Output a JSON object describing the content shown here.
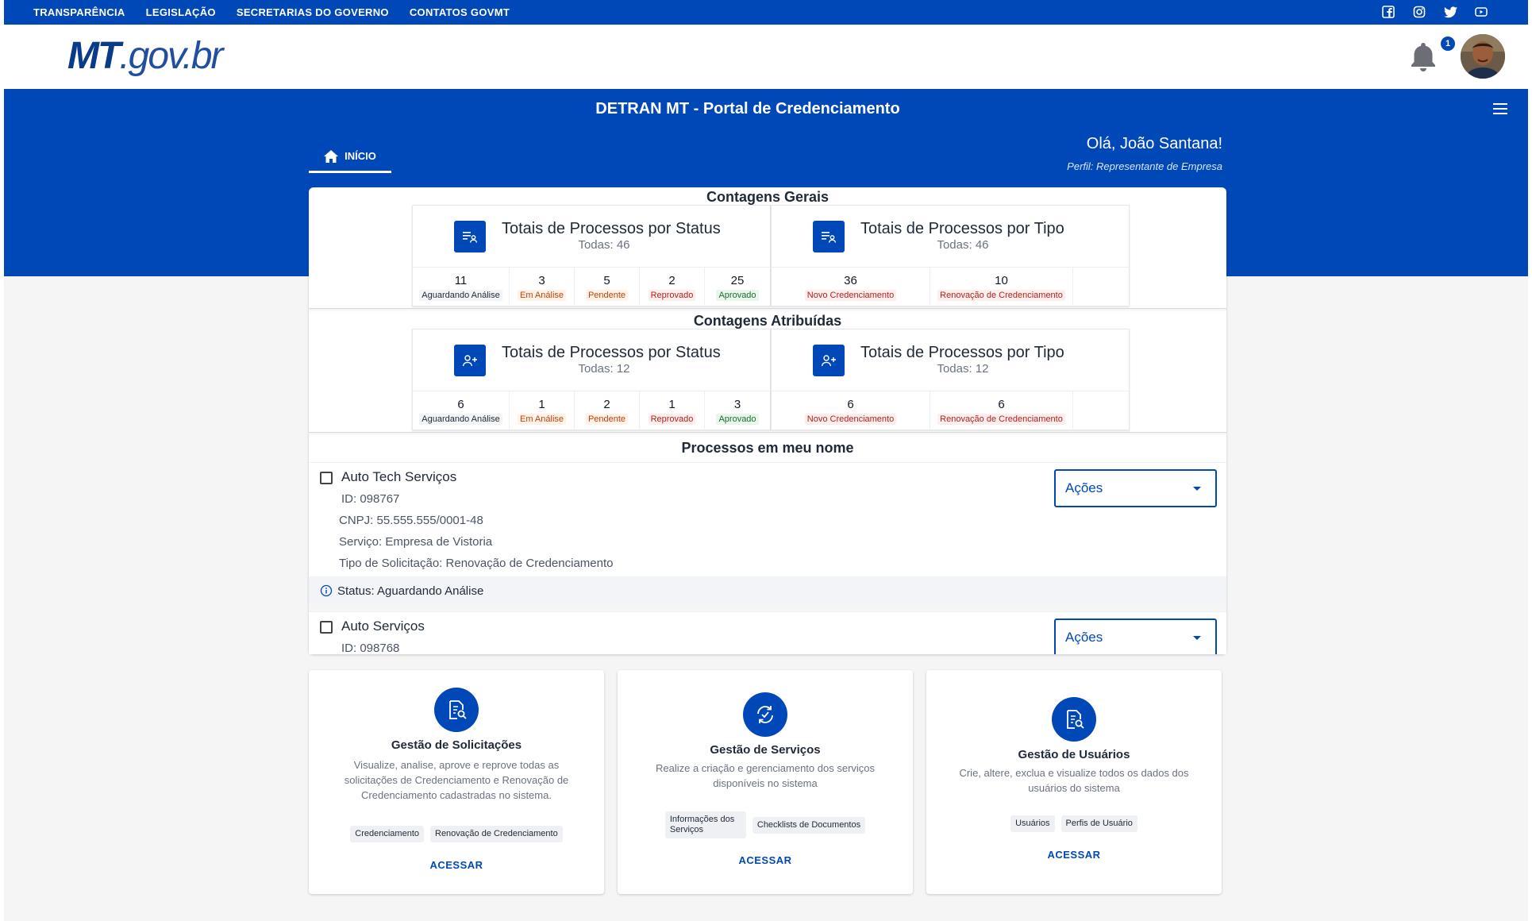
{
  "top_bar": {
    "links": [
      "TRANSPARÊNCIA",
      "LEGISLAÇÃO",
      "SECRETARIAS DO GOVERNO",
      "CONTATOS GOVMT"
    ],
    "social_icons": [
      "facebook-icon",
      "instagram-icon",
      "twitter-icon",
      "youtube-icon"
    ]
  },
  "header": {
    "logo_main": "MT",
    "logo_rest": ".gov.br",
    "notification_count": "1"
  },
  "banner": {
    "title": "DETRAN MT - Portal de Credenciamento",
    "tab_label": "INÍCIO",
    "greeting": "Olá, João Santana!",
    "profile": "Perfil: Representante de Empresa"
  },
  "colors": {
    "brand_blue": "#0048b8",
    "chip_orange": "#c2410c",
    "chip_red": "#b42318",
    "chip_green": "#1e6b2f"
  },
  "contagens_gerais": {
    "title": "Contagens Gerais",
    "status_card": {
      "title": "Totais de Processos por Status",
      "subtitle": "Todas: 46",
      "counts": [
        {
          "value": "11",
          "label": "Aguardando Análise",
          "tone": "neutral"
        },
        {
          "value": "3",
          "label": "Em Análise",
          "tone": "orange"
        },
        {
          "value": "5",
          "label": "Pendente",
          "tone": "orange"
        },
        {
          "value": "2",
          "label": "Reprovado",
          "tone": "red"
        },
        {
          "value": "25",
          "label": "Aprovado",
          "tone": "green"
        }
      ]
    },
    "type_card": {
      "title": "Totais de Processos por Tipo",
      "subtitle": "Todas: 46",
      "counts": [
        {
          "value": "36",
          "label": "Novo Credenciamento",
          "tone": "red"
        },
        {
          "value": "10",
          "label": "Renovação de Credenciamento",
          "tone": "red"
        }
      ]
    }
  },
  "contagens_atribuidas": {
    "title": "Contagens Atribuídas",
    "status_card": {
      "title": "Totais de Processos por Status",
      "subtitle": "Todas: 12",
      "counts": [
        {
          "value": "6",
          "label": "Aguardando Análise",
          "tone": "neutral"
        },
        {
          "value": "1",
          "label": "Em Análise",
          "tone": "orange"
        },
        {
          "value": "2",
          "label": "Pendente",
          "tone": "orange"
        },
        {
          "value": "1",
          "label": "Reprovado",
          "tone": "red"
        },
        {
          "value": "3",
          "label": "Aprovado",
          "tone": "green"
        }
      ]
    },
    "type_card": {
      "title": "Totais de Processos por Tipo",
      "subtitle": "Todas: 12",
      "counts": [
        {
          "value": "6",
          "label": "Novo Credenciamento",
          "tone": "red"
        },
        {
          "value": "6",
          "label": "Renovação de Credenciamento",
          "tone": "red"
        }
      ]
    }
  },
  "processos": {
    "title": "Processos em meu nome",
    "items": [
      {
        "name": "Auto Tech Serviços",
        "id": "ID: 098767",
        "cnpj": "CNPJ: 55.555.555/0001-48",
        "servico": "Serviço: Empresa de Vistoria",
        "tipo": "Tipo de Solicitação: Renovação de Credenciamento",
        "status": "Status: Aguardando Análise",
        "actions_label": "Ações"
      },
      {
        "name": "Auto Serviços",
        "id": "ID: 098768",
        "actions_label": "Ações"
      }
    ]
  },
  "services": [
    {
      "title": "Gestão de Solicitações",
      "description": "Visualize, analise, aprove e reprove todas as solicitações de Credenciamento e Renovação de Credenciamento cadastradas no sistema.",
      "chips": [
        "Credenciamento",
        "Renovação de Credenciamento"
      ],
      "link": "ACESSAR",
      "icon": "document-search-icon"
    },
    {
      "title": "Gestão de Serviços",
      "description": "Realize a criação e gerenciamento dos serviços disponíveis no sistema",
      "chips": [
        "Informações dos Serviços",
        "Checklists de Documentos"
      ],
      "link": "ACESSAR",
      "icon": "refresh-check-icon"
    },
    {
      "title": "Gestão de Usuários",
      "description": "Crie, altere, exclua e visualize todos os dados dos usuários do sistema",
      "chips": [
        "Usuários",
        "Perfis de Usuário"
      ],
      "link": "ACESSAR",
      "icon": "document-search-icon"
    }
  ]
}
